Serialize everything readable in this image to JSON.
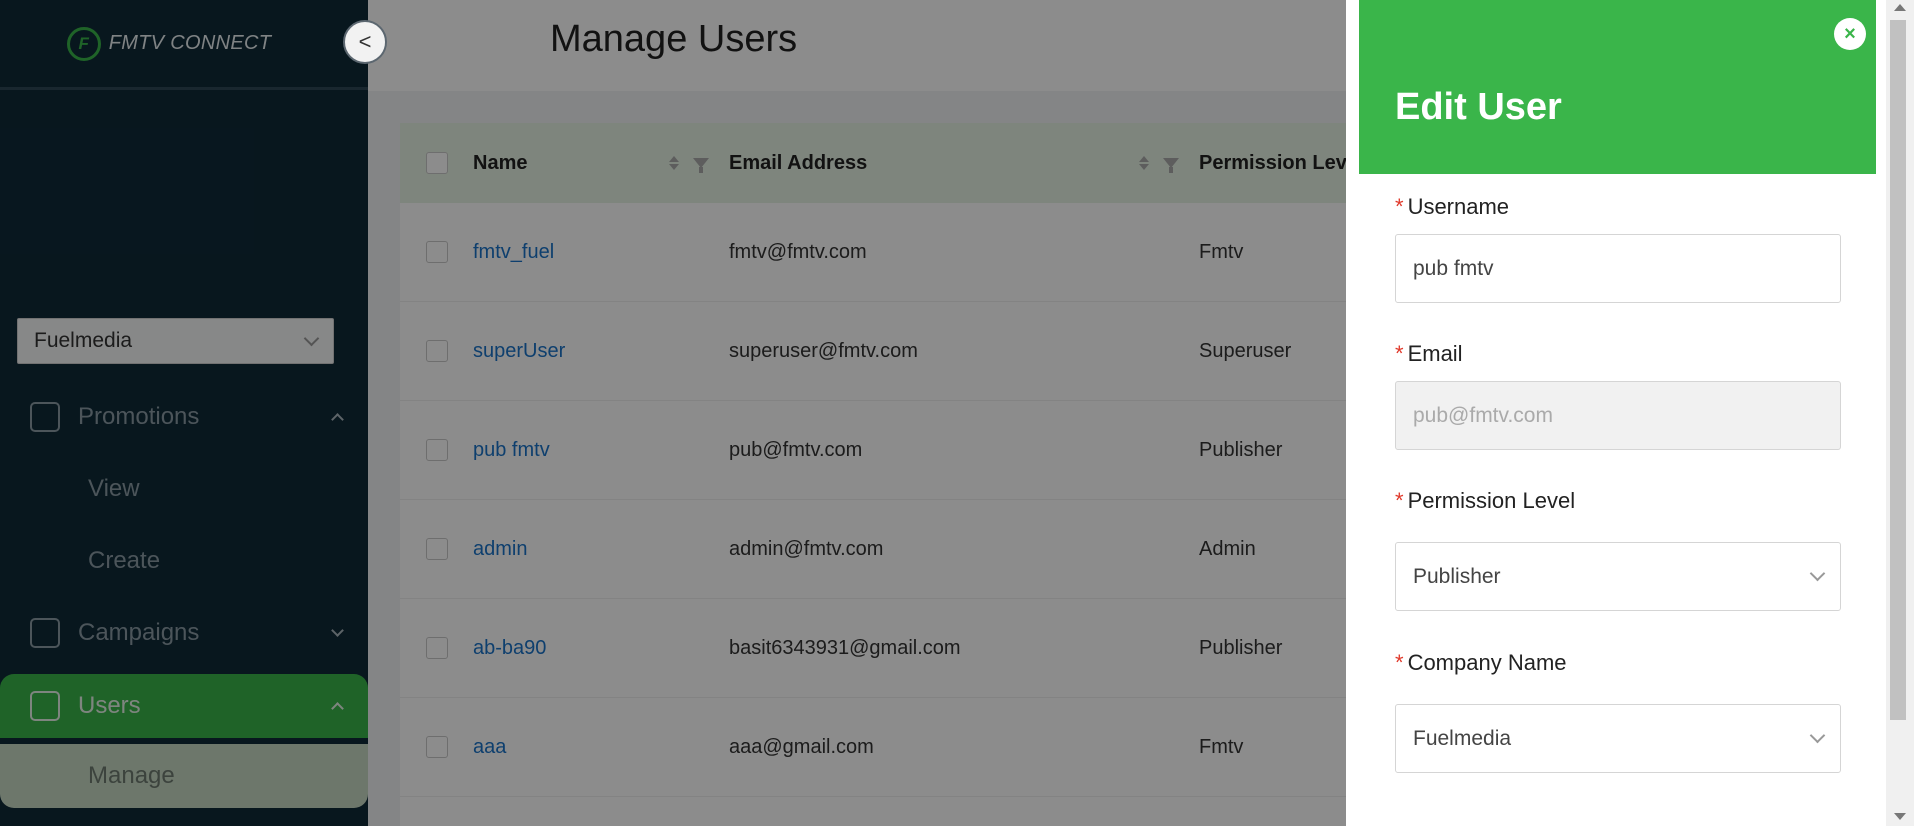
{
  "app": {
    "logo_mark": "F",
    "logo_text": "FMTV CONNECT"
  },
  "sidebar": {
    "collapse_glyph": "<",
    "company_select": "Fuelmedia",
    "nav": [
      {
        "label": "Promotions",
        "icon": "chart-icon",
        "expanded": true
      },
      {
        "label": "View"
      },
      {
        "label": "Create"
      },
      {
        "label": "Campaigns",
        "icon": "trend-icon",
        "expanded": false
      },
      {
        "label": "Users",
        "icon": "users-icon",
        "expanded": true
      },
      {
        "label": "Manage"
      }
    ]
  },
  "main": {
    "title": "Manage Users",
    "table": {
      "columns": [
        "Name",
        "Email Address",
        "Permission Level"
      ],
      "rows": [
        {
          "name": "fmtv_fuel",
          "email": "fmtv@fmtv.com",
          "permission": "Fmtv"
        },
        {
          "name": "superUser",
          "email": "superuser@fmtv.com",
          "permission": "Superuser"
        },
        {
          "name": "pub fmtv",
          "email": "pub@fmtv.com",
          "permission": "Publisher"
        },
        {
          "name": "admin",
          "email": "admin@fmtv.com",
          "permission": "Admin"
        },
        {
          "name": "ab-ba90",
          "email": "basit6343931@gmail.com",
          "permission": "Publisher"
        },
        {
          "name": "aaa",
          "email": "aaa@gmail.com",
          "permission": "Fmtv"
        }
      ]
    }
  },
  "drawer": {
    "title": "Edit User",
    "close_glyph": "×",
    "required_mark": "*",
    "fields": {
      "username": {
        "label": "Username",
        "value": "pub fmtv"
      },
      "email": {
        "label": "Email",
        "placeholder": "pub@fmtv.com"
      },
      "permission": {
        "label": "Permission Level",
        "value": "Publisher"
      },
      "company": {
        "label": "Company Name",
        "value": "Fuelmedia"
      }
    }
  },
  "colors": {
    "brand_green": "#3ab54a",
    "sidebar_bg": "#0f2a38",
    "link_blue": "#1a73c8"
  }
}
